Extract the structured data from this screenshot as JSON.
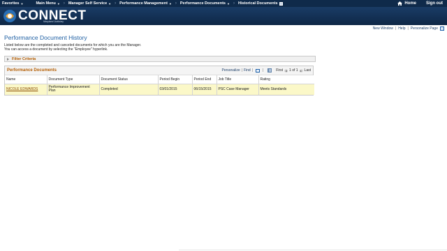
{
  "topnav": {
    "items": [
      {
        "label": "Favorites"
      },
      {
        "label": "Main Menu"
      },
      {
        "label": "Manager Self Service"
      },
      {
        "label": "Performance Management"
      },
      {
        "label": "Performance Documents"
      },
      {
        "label": "Historical Documents"
      }
    ],
    "home_label": "Home",
    "signout_label": "Sign out"
  },
  "banner": {
    "logo_text": "CONNECT",
    "logo_sub": "Maryland Judiciary"
  },
  "util_links": {
    "new_window": "New Window",
    "help": "Help",
    "personalize_page": "Personalize Page"
  },
  "page": {
    "title": "Performance Document History",
    "instructions_line1": "Listed below are the completed and canceled documents for which you are the Manager.",
    "instructions_line2": "You can access a document by selecting the \"Employee\" hyperlink."
  },
  "filter": {
    "label": "Filter Criteria"
  },
  "grid": {
    "title": "Performance Documents",
    "personalize": "Personalize",
    "find": "Find",
    "first": "First",
    "range": "1 of 1",
    "last": "Last",
    "columns": [
      "Name",
      "Document Type",
      "Document Status",
      "Period Begin",
      "Period End",
      "Job Title",
      "Rating"
    ],
    "rows": [
      {
        "name": "NICOLE EDWARDS",
        "doc_type": "Performance Improvement Plan",
        "status": "Completed",
        "period_begin": "03/01/2015",
        "period_end": "06/15/2015",
        "job_title": "PSC Case Manager",
        "rating": "Meets Standards"
      }
    ]
  },
  "colors": {
    "nav_bg": "#0f2a4a",
    "title_blue": "#1e5fa3",
    "section_orange": "#b35c00",
    "row_highlight": "#fbf8c8"
  }
}
